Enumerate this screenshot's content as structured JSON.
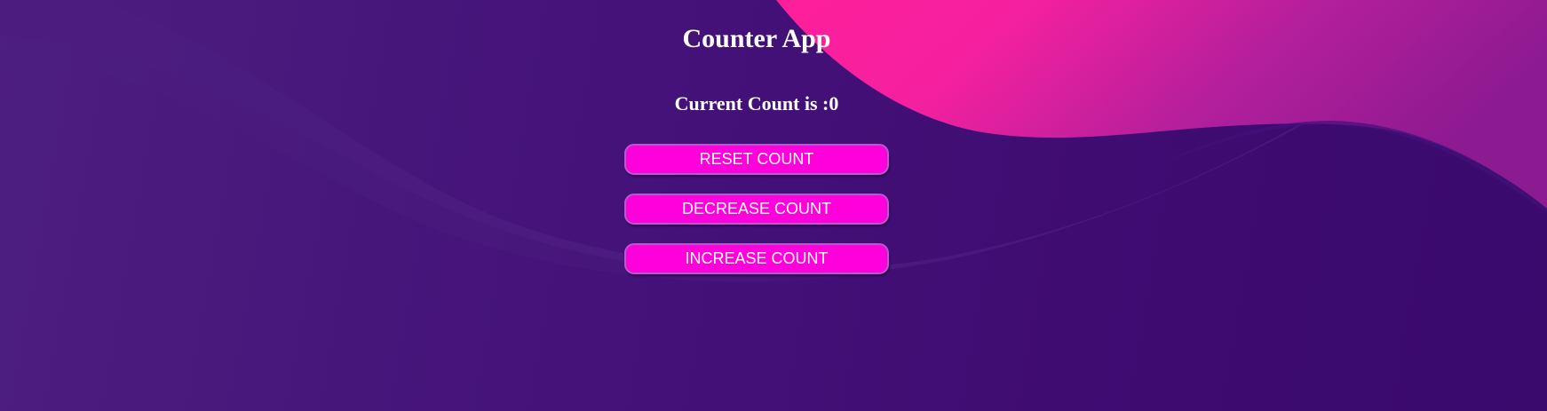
{
  "app": {
    "title": "Counter App",
    "count_label": "Current Count is :",
    "count_value": "0"
  },
  "buttons": {
    "reset_label": "RESET COUNT",
    "decrease_label": "DECREASE COUNT",
    "increase_label": "INCREASE COUNT"
  },
  "colors": {
    "background": "#421070",
    "wave_pink": "#ff1f9b",
    "button": "#ff00dc",
    "text": "#ffffff"
  }
}
